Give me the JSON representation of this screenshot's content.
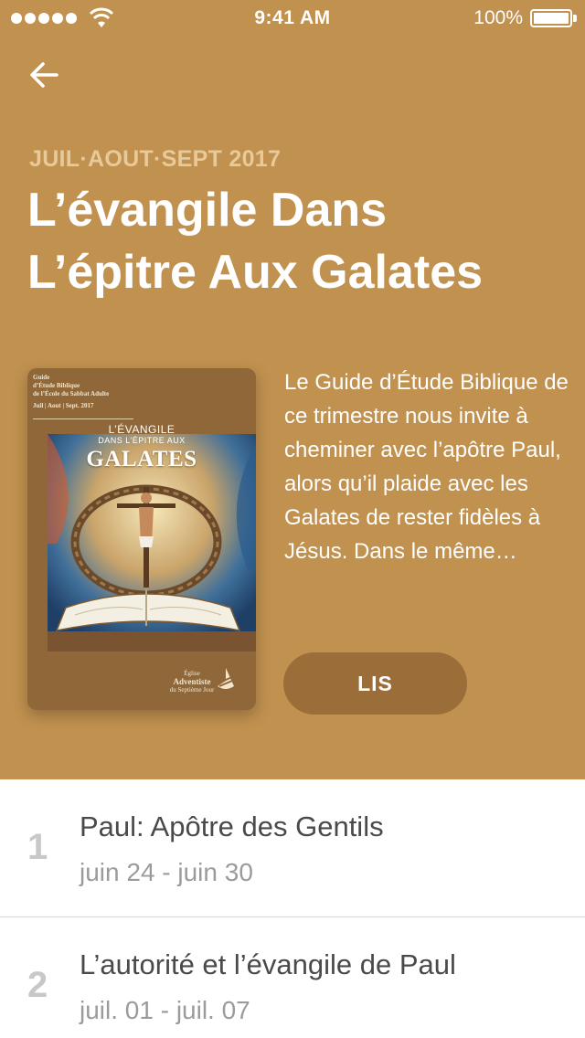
{
  "status_bar": {
    "time": "9:41 AM",
    "battery": "100%"
  },
  "quarter_label": "JUIL·AOUT·SEPT 2017",
  "title_line1": "L’évangile Dans",
  "title_line2": "L’épitre Aux Galates",
  "cover": {
    "header_lines": [
      "Guide",
      "d’Étude Biblique",
      "de l’École du Sabbat Adulte",
      "Juil | Aout | Sept. 2017"
    ],
    "title_small": "L’ÉVANGILE",
    "title_sub": "DANS L’ÉPITRE AUX",
    "title_big": "GALATES",
    "org_lines": [
      "Église",
      "Adventiste",
      "du Septième Jour"
    ]
  },
  "description": "Le Guide d’Étude Biblique de ce trimestre nous invite à cheminer avec l’apôtre Paul, alors qu’il plaide avec les Galates de rester fidèles à Jésus. Dans le même…",
  "read_button": "LIS",
  "lessons": [
    {
      "number": "1",
      "title": "Paul: Apôtre des Gentils",
      "dates": "juin 24 - juin 30"
    },
    {
      "number": "2",
      "title": "L’autorité et l’évangile de Paul",
      "dates": "juil. 01 - juil. 07"
    }
  ],
  "colors": {
    "hero_bg": "#c1914f",
    "button_bg": "#9b6d39",
    "quarter_text": "#e8c99a"
  }
}
